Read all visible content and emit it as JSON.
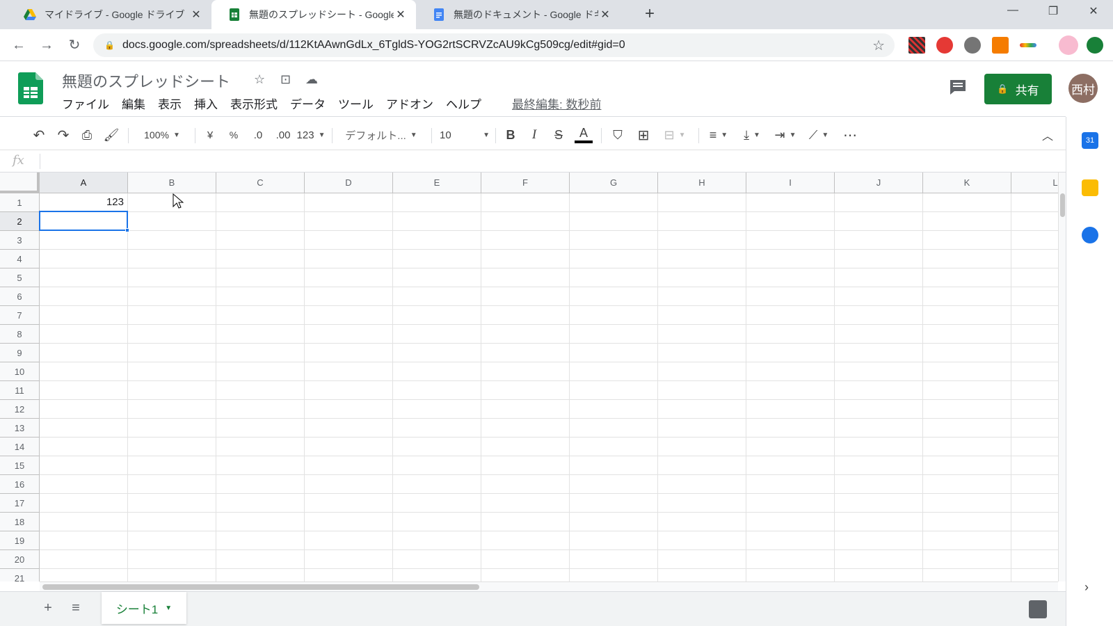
{
  "browser": {
    "tabs": [
      {
        "title": "マイドライブ - Google ドライブ",
        "icon": "google-drive-icon",
        "active": false
      },
      {
        "title": "無題のスプレッドシート - Google スプ",
        "icon": "google-sheets-icon",
        "active": true
      },
      {
        "title": "無題のドキュメント - Google ドキュメ",
        "icon": "google-docs-icon",
        "active": false
      }
    ],
    "new_tab": "+",
    "url": "docs.google.com/spreadsheets/d/112KtAAwnGdLx_6TgldS-YOG2rtSCRVZcAU9kCg509cg/edit#gid=0"
  },
  "app": {
    "doc_title": "無題のスプレッドシート",
    "menu": [
      "ファイル",
      "編集",
      "表示",
      "挿入",
      "表示形式",
      "データ",
      "ツール",
      "アドオン",
      "ヘルプ"
    ],
    "last_edit": "最終編集: 数秒前",
    "share_label": "共有",
    "avatar_label": "西村",
    "accent_color": "#188038"
  },
  "toolbar": {
    "zoom": "100%",
    "currency": "¥",
    "percent": "%",
    "decimal_decrease": ".0",
    "decimal_increase": ".00",
    "number_format": "123",
    "font": "デフォルト...",
    "font_size": "10",
    "bold": "B",
    "italic": "I",
    "strike": "S",
    "text_color": "A",
    "more": "⋯"
  },
  "formula_bar": {
    "fx": "fx",
    "value": ""
  },
  "grid": {
    "columns": [
      "A",
      "B",
      "C",
      "D",
      "E",
      "F",
      "G",
      "H",
      "I",
      "J",
      "K",
      "L"
    ],
    "rows": [
      "1",
      "2",
      "3",
      "4",
      "5",
      "6",
      "7",
      "8",
      "9",
      "10",
      "11",
      "12",
      "13",
      "14",
      "15",
      "16",
      "17",
      "18",
      "19",
      "20",
      "21"
    ],
    "cells": {
      "A1": "123"
    },
    "selected_cell": "A2"
  },
  "sheets": {
    "tabs": [
      {
        "label": "シート1",
        "active": true
      }
    ]
  }
}
